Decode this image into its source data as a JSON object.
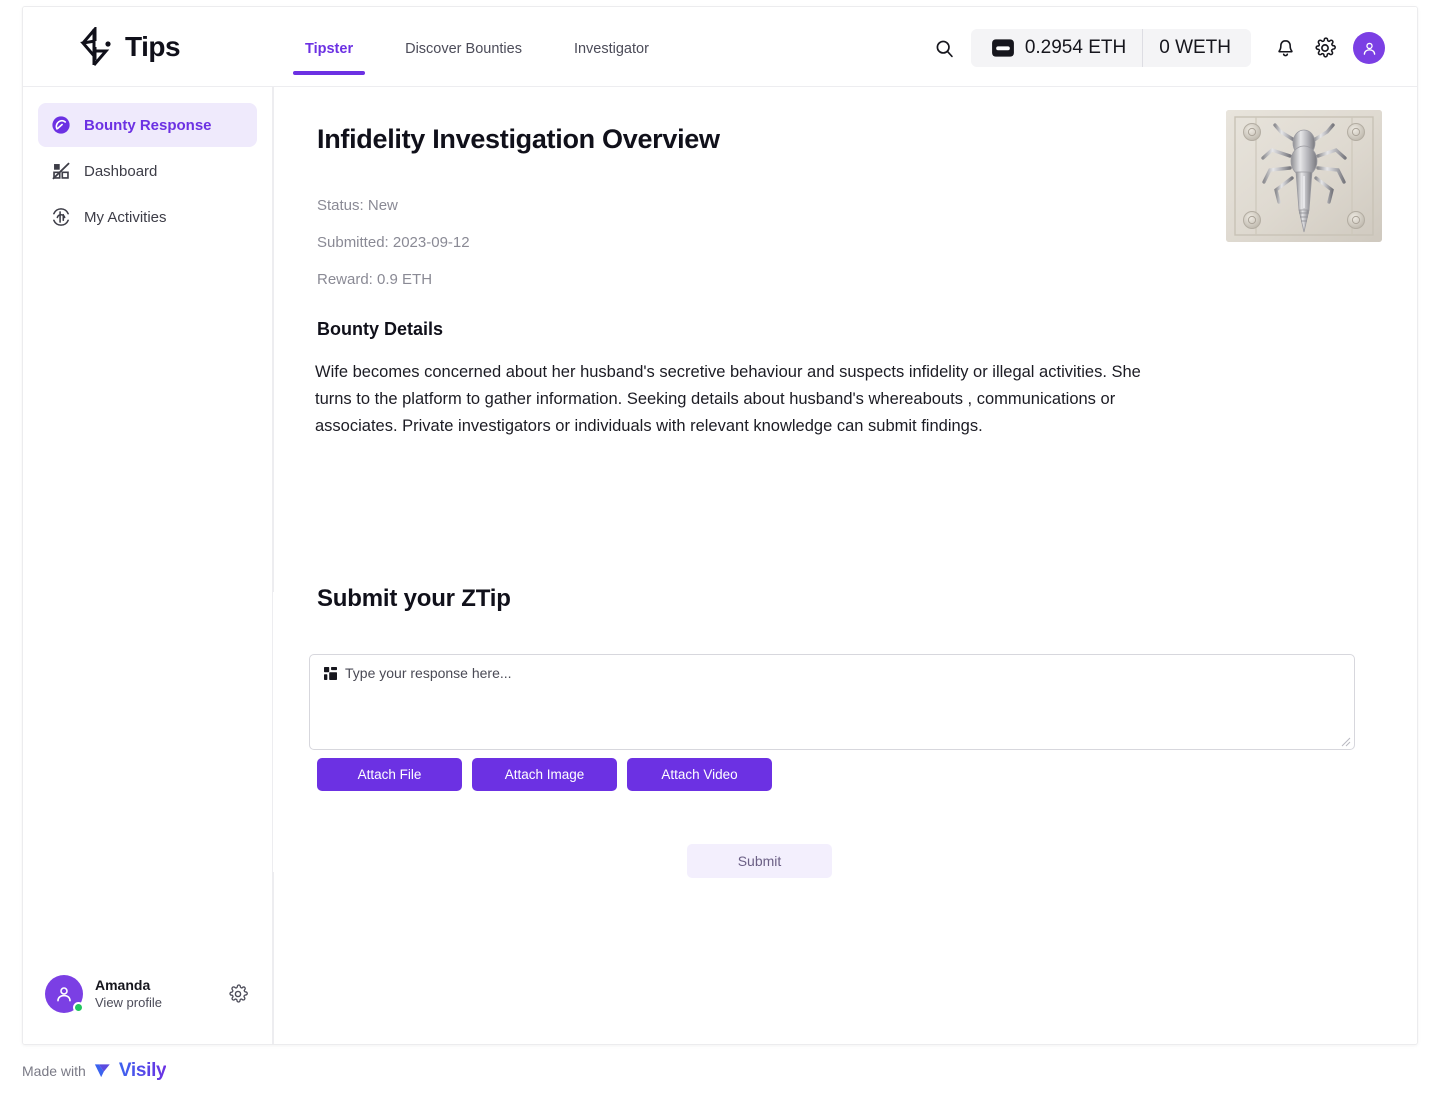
{
  "brand": {
    "name": "Tips",
    "logo_icon": "tips-logo-icon"
  },
  "header": {
    "tabs": [
      {
        "label": "Tipster",
        "active": true
      },
      {
        "label": "Discover Bounties",
        "active": false
      },
      {
        "label": "Investigator",
        "active": false
      }
    ],
    "search_icon": "search-icon",
    "wallet": {
      "wallet_icon": "wallet-icon",
      "eth_balance": "0.2954 ETH",
      "weth_balance": "0 WETH"
    },
    "notifications_icon": "bell-icon",
    "settings_icon": "gear-icon",
    "avatar_icon": "user-avatar-icon"
  },
  "sidebar": {
    "items": [
      {
        "label": "Bounty Response",
        "icon": "gauge-icon",
        "active": true
      },
      {
        "label": "Dashboard",
        "icon": "dashboard-slash-icon",
        "active": false
      },
      {
        "label": "My Activities",
        "icon": "activity-icon",
        "active": false
      }
    ],
    "profile": {
      "name": "Amanda",
      "link": "View profile",
      "avatar_icon": "user-avatar-icon",
      "status": "online",
      "settings_icon": "gear-icon"
    }
  },
  "main": {
    "page_title": "Infidelity Investigation Overview",
    "meta": {
      "status_label": "Status:",
      "status_value": "New",
      "submitted_label": "Submitted:",
      "submitted_value": "2023-09-12",
      "reward_label": "Reward:",
      "reward_value": "0.9 ETH"
    },
    "meta_lines": {
      "status": "Status:  New",
      "submitted": "Submitted: 2023-09-12",
      "reward": "Reward:  0.9 ETH"
    },
    "details_heading": "Bounty Details",
    "details_text": " Wife becomes concerned about her husband's  secretive behaviour and suspects infidelity or illegal activities. She turns to the platform to gather information. Seeking details about husband's whereabouts , communications or associates.  Private investigators or individuals with relevant knowledge can submit findings.",
    "hero_image_alt": "metallic-insect-sculpture-on-panel",
    "submit_section_title": "Submit your ZTip",
    "response_input": {
      "value": "",
      "placeholder": "Type your  response  here...",
      "leading_icon": "grid-blocks-icon"
    },
    "attach_buttons": [
      {
        "label": "Attach File",
        "name": "attach-file-button"
      },
      {
        "label": "Attach Image",
        "name": "attach-image-button"
      },
      {
        "label": "Attach Video",
        "name": "attach-video-button"
      }
    ],
    "submit_button": "Submit"
  },
  "footer": {
    "made_with": "Made with",
    "product": "Visily"
  },
  "colors": {
    "accent_purple": "#6c31e3",
    "accent_purple_soft": "#efeafc",
    "submit_bg": "#f3effd",
    "online_green": "#22c55e",
    "text_dark": "#10101a",
    "text_muted": "#8a8a95"
  }
}
